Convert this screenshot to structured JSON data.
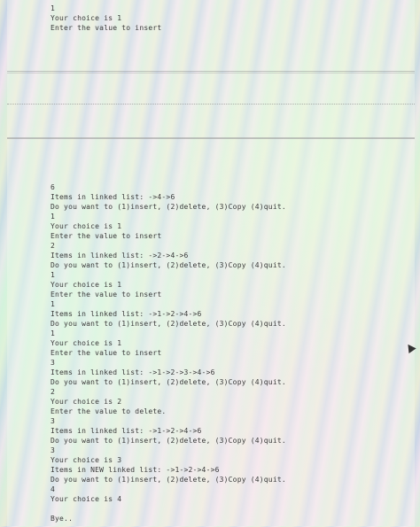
{
  "top_console": [
    "1",
    "Your choice is 1",
    "Enter the value to insert"
  ],
  "main_console": [
    "6",
    "Items in linked list: ->4->6",
    "Do you want to (1)insert, (2)delete, (3)Copy (4)quit.",
    "1",
    "Your choice is 1",
    "Enter the value to insert",
    "2",
    "Items in linked list: ->2->4->6",
    "Do you want to (1)insert, (2)delete, (3)Copy (4)quit.",
    "1",
    "Your choice is 1",
    "Enter the value to insert",
    "1",
    "Items in linked list: ->1->2->4->6",
    "Do you want to (1)insert, (2)delete, (3)Copy (4)quit.",
    "1",
    "Your choice is 1",
    "Enter the value to insert",
    "3",
    "Items in linked list: ->1->2->3->4->6",
    "Do you want to (1)insert, (2)delete, (3)Copy (4)quit.",
    "2",
    "Your choice is 2",
    "Enter the value to delete.",
    "3",
    "Items in linked list: ->1->2->4->6",
    "Do you want to (1)insert, (2)delete, (3)Copy (4)quit.",
    "3",
    "Your choice is 3",
    "Items in NEW linked list: ->1->2->4->6",
    "Do you want to (1)insert, (2)delete, (3)Copy (4)quit.",
    "4",
    "Your choice is 4",
    "",
    "Bye.."
  ],
  "colors": {
    "text": "#3a3a3a",
    "divider": "#969696"
  }
}
